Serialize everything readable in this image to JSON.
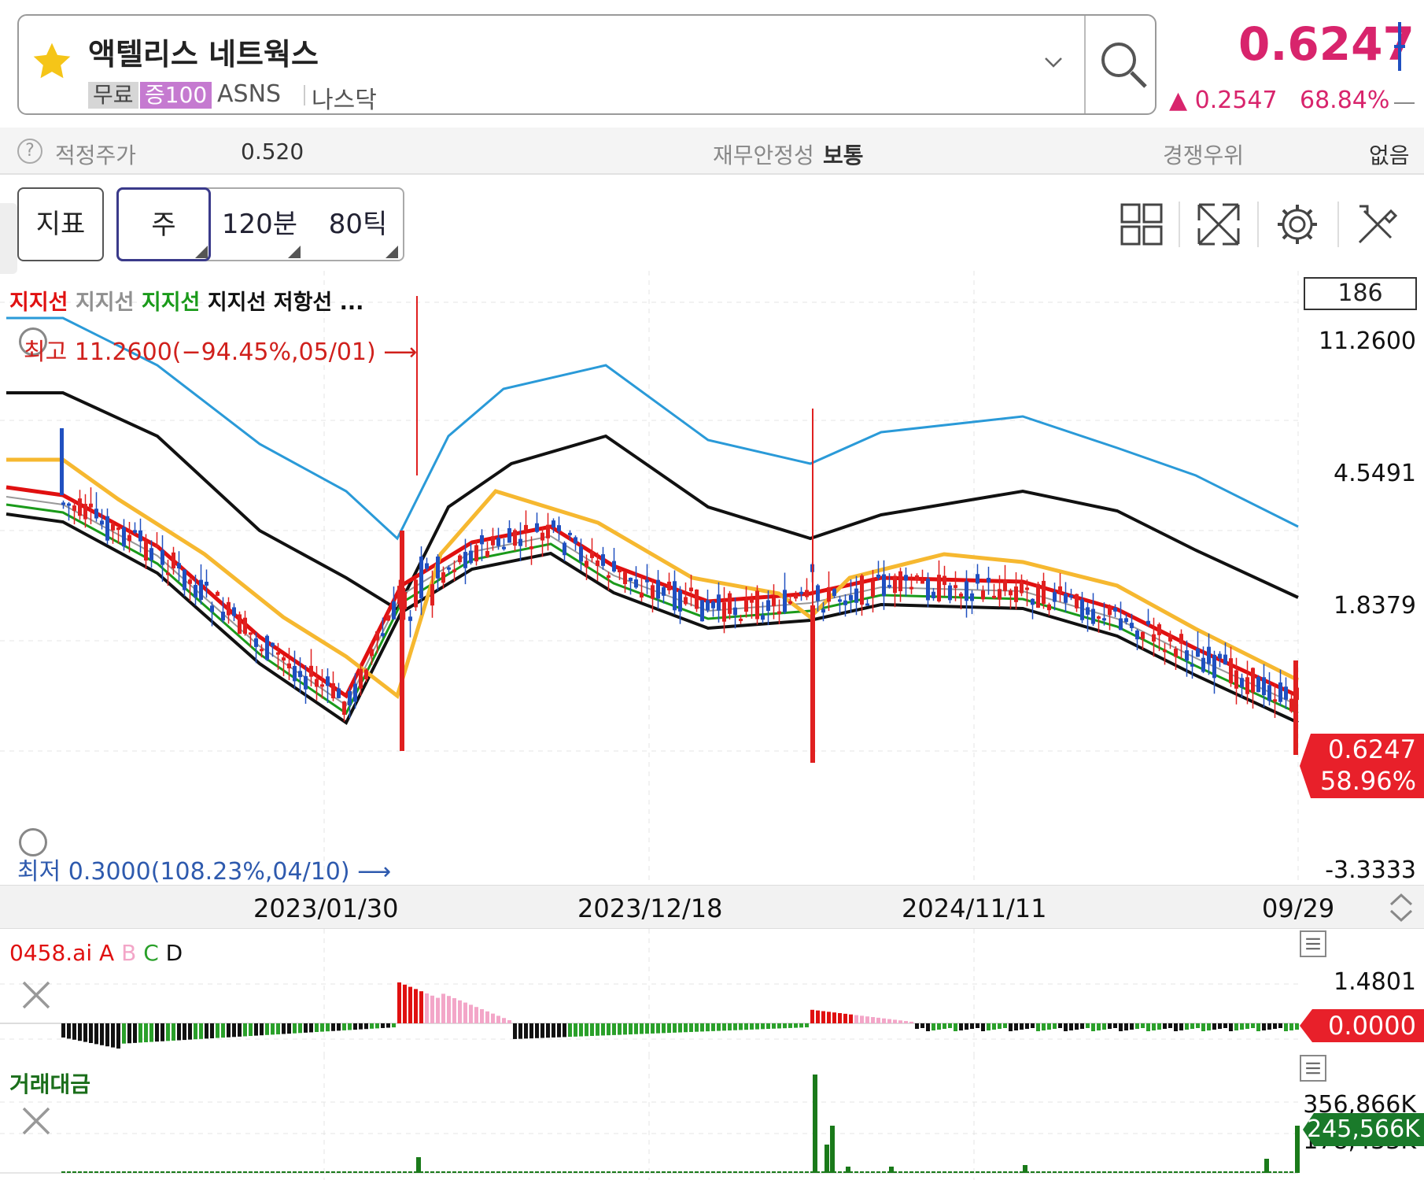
{
  "header": {
    "stock_name": "액텔리스 네트웍스",
    "tag_free": "무료",
    "tag_margin": "증100",
    "ticker": "ASNS",
    "exchange": "나스닥",
    "price": "0.6247",
    "change": "▲ 0.2547",
    "change_pct": "68.84%"
  },
  "info": {
    "fair_price_label": "적정주가",
    "fair_price_value": "0.520",
    "stability_label": "재무안정성",
    "stability_value": "보통",
    "competitive_label": "경쟁우위",
    "competitive_value": "없음"
  },
  "toolbar": {
    "indicator_label": "지표",
    "week_label": "주",
    "min_label": "120분",
    "tick_label": "80틱"
  },
  "main_chart": {
    "legend": [
      {
        "text": "지지선",
        "color": "#e01010"
      },
      {
        "text": "지지선",
        "color": "#909090"
      },
      {
        "text": "지지선",
        "color": "#1a9a1a"
      },
      {
        "text": "지지선",
        "color": "#111111"
      },
      {
        "text": "저항선 ...",
        "color": "#111111"
      }
    ],
    "count": "186",
    "y_labels": [
      "11.2600",
      "4.5491",
      "1.8379",
      "-3.3333"
    ],
    "high_label": "최고 11.2600(−94.45%,05/01) ⟶",
    "low_label": "최저 0.3000(108.23%,04/10) ⟶",
    "current_price": "0.6247",
    "current_pct": "58.96%",
    "x_labels": [
      "2023/01/30",
      "2023/12/18",
      "2024/11/11",
      "09/29"
    ]
  },
  "oscillator": {
    "legend": [
      {
        "text": "0458.ai",
        "color": "#e01010"
      },
      {
        "text": "A",
        "color": "#e01010"
      },
      {
        "text": "B",
        "color": "#f3a6c8"
      },
      {
        "text": "C",
        "color": "#2aa02a"
      },
      {
        "text": "D",
        "color": "#111111"
      }
    ],
    "y_top": "1.4801",
    "current": "0.0000"
  },
  "volume": {
    "legend": "거래대금",
    "y_top": "356,866K",
    "y_mid": "178,433K",
    "current": "245,566K"
  },
  "colors": {
    "accent": "#d8246c",
    "up": "#e02020",
    "down": "#2050c0"
  },
  "chart_data": {
    "type": "candlestick",
    "ylim": [
      0.3,
      11.26
    ],
    "x_ticks": [
      "2023/01/30",
      "2023/12/18",
      "2024/11/11",
      "09/29"
    ],
    "last_close": 0.6247,
    "high": 11.26,
    "low": 0.3
  }
}
